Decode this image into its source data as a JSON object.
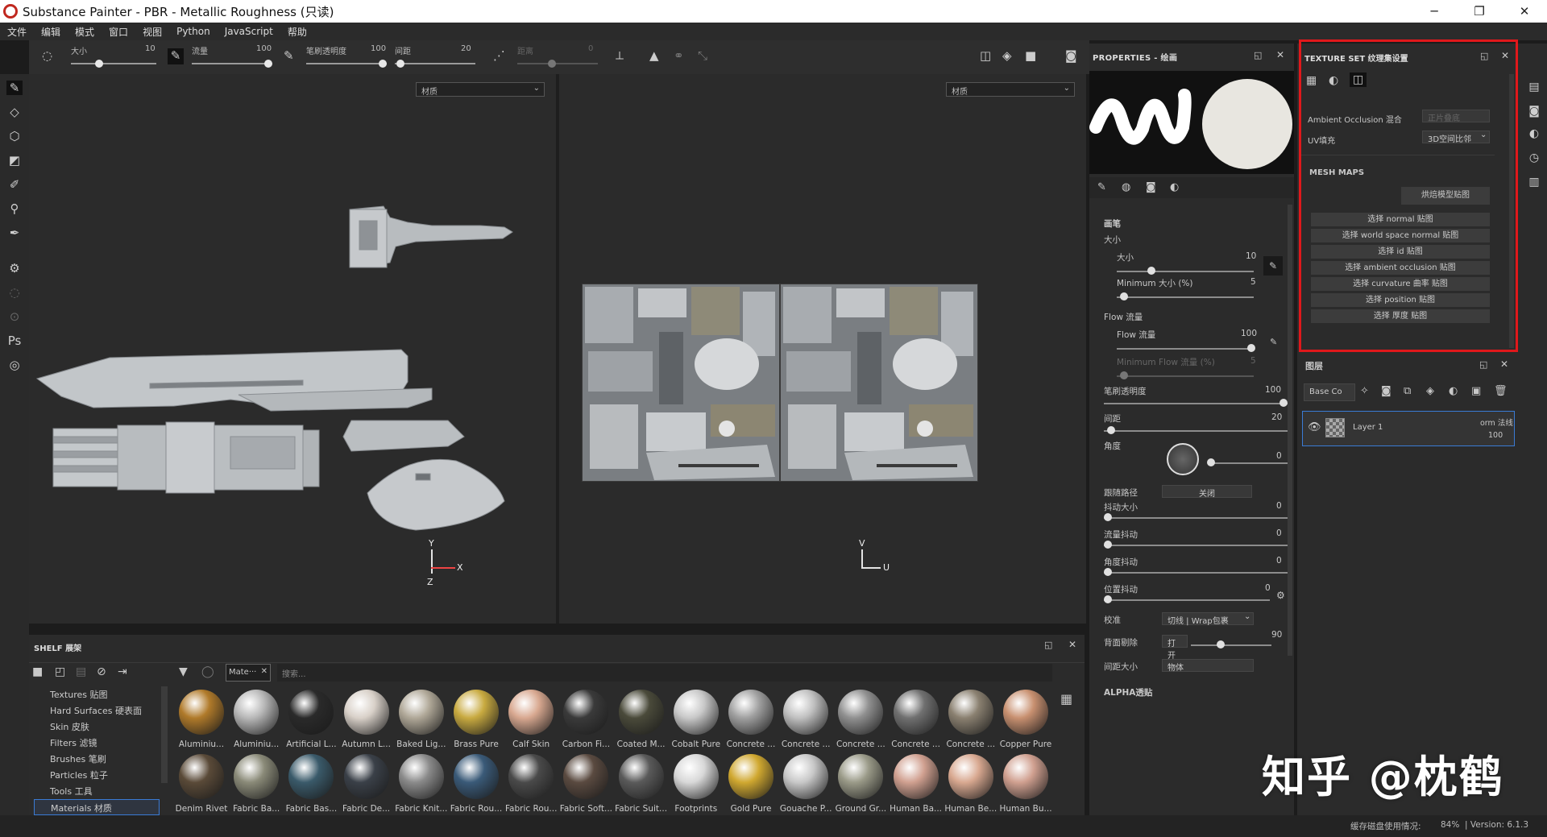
{
  "window": {
    "title": "Substance Painter - PBR - Metallic Roughness (只读)",
    "min": "─",
    "max": "❐",
    "close": "✕"
  },
  "menu": [
    "文件",
    "编辑",
    "模式",
    "窗口",
    "视图",
    "Python",
    "JavaScript",
    "帮助"
  ],
  "toolbar": {
    "size_label": "大小",
    "size_value": "10",
    "flow_label": "流量",
    "flow_value": "100",
    "opacity_label": "笔刷透明度",
    "opacity_value": "100",
    "spacing_label": "间距",
    "spacing_value": "20",
    "distance_label": "距离",
    "distance_value": "0"
  },
  "viewport": {
    "left_select": "材质",
    "right_select": "材质",
    "axes_3d": {
      "y": "Y",
      "x": "X",
      "z": "Z"
    },
    "axes_2d": {
      "v": "V",
      "u": "U"
    }
  },
  "shelf": {
    "title": "SHELF 展架",
    "filter_tag": "Mate···",
    "search_placeholder": "搜索...",
    "categories": [
      "Textures 贴图",
      "Hard Surfaces 硬表面",
      "Skin 皮肤",
      "Filters 滤镜",
      "Brushes 笔刷",
      "Particles 粒子",
      "Tools 工具",
      "Materials 材质"
    ],
    "materials_row1": [
      "Aluminiu...",
      "Aluminiu...",
      "Artificial L...",
      "Autumn L...",
      "Baked Lig...",
      "Brass Pure",
      "Calf Skin",
      "Carbon Fi...",
      "Coated M...",
      "Cobalt Pure",
      "Concrete ...",
      "Concrete ...",
      "Concrete ...",
      "Concrete ...",
      "Concrete ...",
      "Copper Pure"
    ],
    "materials_row2": [
      "Denim Rivet",
      "Fabric Ba...",
      "Fabric Bas...",
      "Fabric De...",
      "Fabric Knit...",
      "Fabric Rou...",
      "Fabric Rou...",
      "Fabric Soft...",
      "Fabric Suit...",
      "Footprints",
      "Gold Pure",
      "Gouache P...",
      "Ground Gr...",
      "Human Ba...",
      "Human Be...",
      "Human Bu..."
    ],
    "colors_row1": [
      "#b07a2a",
      "#b8b8b8",
      "#2a2a2a",
      "#d8d0c8",
      "#b0a898",
      "#c8aa40",
      "#d8a890",
      "#3a3a3a",
      "#4a4a3a",
      "#c8c8c8",
      "#a0a0a0",
      "#c0c0c0",
      "#909090",
      "#707070",
      "#8a8070",
      "#c89070"
    ],
    "colors_row2": [
      "#5a4a38",
      "#8a8a78",
      "#3a5a6a",
      "#3a4048",
      "#8a8a8a",
      "#3a5a78",
      "#4a4a4a",
      "#5a4a40",
      "#5a5a5a",
      "#d8d8d8",
      "#d0a830",
      "#c8c8c8",
      "#9a9a88",
      "#d0a090",
      "#d8a890",
      "#d0a090"
    ]
  },
  "properties": {
    "title": "PROPERTIES - 绘画",
    "brush_section": "画笔",
    "size_group": "大小",
    "size_label": "大小",
    "size_value": "10",
    "min_size_label": "Minimum 大小 (%)",
    "min_size_value": "5",
    "flow_group": "Flow 流量",
    "flow_label": "Flow 流量",
    "flow_value": "100",
    "min_flow_label": "Minimum Flow 流量 (%)",
    "min_flow_value": "5",
    "opacity_label": "笔刷透明度",
    "opacity_value": "100",
    "spacing_label": "间距",
    "spacing_value": "20",
    "angle_label": "角度",
    "angle_value": "0",
    "follow_path_label": "跟随路径",
    "follow_path_value": "关闭",
    "jitter_size_label": "抖动大小",
    "jitter_size_value": "0",
    "jitter_flow_label": "流量抖动",
    "jitter_flow_value": "0",
    "jitter_angle_label": "角度抖动",
    "jitter_angle_value": "0",
    "jitter_pos_label": "位置抖动",
    "jitter_pos_value": "0",
    "alignment_label": "校准",
    "alignment_value": "切线 | Wrap包裹",
    "backface_label": "背面剔除",
    "backface_value": "打开",
    "backface_num": "90",
    "spacing_size_label": "间距大小",
    "spacing_size_value": "物体",
    "alpha_section": "ALPHA透贴"
  },
  "texture_set": {
    "title": "TEXTURE SET 纹理集设置",
    "ao_label": "Ambient Occlusion 混合",
    "ao_placeholder": "正片叠底",
    "uv_label": "UV填充",
    "uv_value": "3D空间比邻",
    "mesh_maps": "MESH MAPS",
    "bake_button": "烘焙模型贴图",
    "maps": [
      "选择 normal 贴图",
      "选择 world space normal 贴图",
      "选择 id 贴图",
      "选择 ambient occlusion 贴图",
      "选择 curvature 曲率 贴图",
      "选择 position 贴图",
      "选择 厚度 贴图"
    ]
  },
  "layers": {
    "title": "图层",
    "channel_select": "Base Co",
    "layer_name": "Layer 1",
    "blend_mode": "orm 法线",
    "opacity": "100"
  },
  "status": {
    "disk_label": "缓存磁盘使用情况:",
    "disk_value": "84%",
    "version": "| Version: 6.1.3"
  },
  "watermark": "知乎 @枕鹤"
}
